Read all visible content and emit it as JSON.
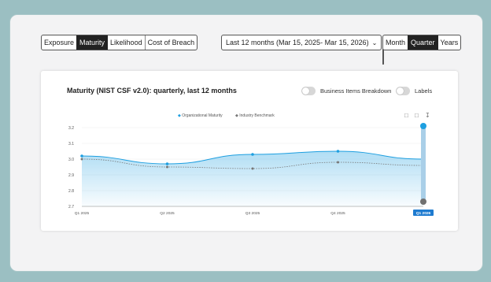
{
  "tabs": {
    "items": [
      {
        "label": "Exposure",
        "active": false
      },
      {
        "label": "Maturity",
        "active": true
      },
      {
        "label": "Likelihood",
        "active": false
      },
      {
        "label": "Cost of Breach",
        "active": false
      }
    ]
  },
  "date_range": {
    "label": "Last 12 months (Mar 15, 2025- Mar 15, 2026)",
    "icon": "chevron-down-icon"
  },
  "period": {
    "items": [
      {
        "label": "Month",
        "active": false
      },
      {
        "label": "Quarter",
        "active": true
      },
      {
        "label": "Years",
        "active": false
      }
    ]
  },
  "card": {
    "title": "Maturity (NIST CSF v2.0): quarterly, last 12 months",
    "toggles": {
      "breakdown_label": "Business Items Breakdown",
      "labels_label": "Labels"
    },
    "toolbar_icons": [
      "zoom-in-icon",
      "zoom-out-icon",
      "download-icon"
    ]
  },
  "colors": {
    "org": "#1e9fe0",
    "bench": "#777777",
    "highlight": "#1e7bd0"
  },
  "chart_data": {
    "type": "line",
    "categories": [
      "Q1 2025",
      "Q2 2025",
      "Q3 2025",
      "Q4 2025",
      "Q1 2026"
    ],
    "series": [
      {
        "name": "Organizational Maturity",
        "values": [
          3.02,
          2.97,
          3.03,
          3.05,
          3.0
        ]
      },
      {
        "name": "Industry Benchmark",
        "values": [
          3.0,
          2.95,
          2.94,
          2.98,
          2.96
        ]
      }
    ],
    "yticks": [
      "3.2",
      "3.1",
      "3.0",
      "2.9",
      "2.8",
      "2.7"
    ],
    "ylim": [
      2.7,
      3.2
    ],
    "highlight_category": "Q1 2026",
    "grid": true,
    "legend_position": "top-center"
  }
}
